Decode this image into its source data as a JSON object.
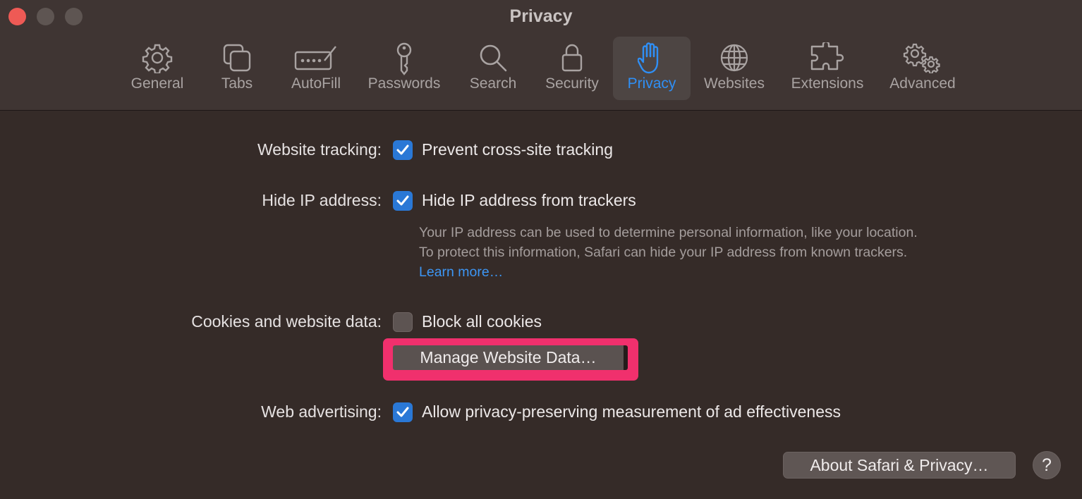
{
  "window": {
    "title": "Privacy"
  },
  "toolbar": {
    "tabs": [
      {
        "label": "General",
        "icon": "gear-icon"
      },
      {
        "label": "Tabs",
        "icon": "tabs-icon"
      },
      {
        "label": "AutoFill",
        "icon": "autofill-icon"
      },
      {
        "label": "Passwords",
        "icon": "key-icon"
      },
      {
        "label": "Search",
        "icon": "search-icon"
      },
      {
        "label": "Security",
        "icon": "lock-icon"
      },
      {
        "label": "Privacy",
        "icon": "hand-icon",
        "selected": true
      },
      {
        "label": "Websites",
        "icon": "globe-icon"
      },
      {
        "label": "Extensions",
        "icon": "puzzle-icon"
      },
      {
        "label": "Advanced",
        "icon": "gears-icon"
      }
    ]
  },
  "settings": {
    "website_tracking": {
      "label": "Website tracking:",
      "option": "Prevent cross-site tracking",
      "checked": true
    },
    "hide_ip": {
      "label": "Hide IP address:",
      "option": "Hide IP address from trackers",
      "checked": true,
      "description": "Your IP address can be used to determine personal information, like your location. To protect this information, Safari can hide your IP address from known trackers.",
      "learn_more": "Learn more…"
    },
    "cookies": {
      "label": "Cookies and website data:",
      "option": "Block all cookies",
      "checked": false,
      "manage_button": "Manage Website Data…"
    },
    "web_advertising": {
      "label": "Web advertising:",
      "option": "Allow privacy-preserving measurement of ad effectiveness",
      "checked": true
    }
  },
  "footer": {
    "about_button": "About Safari & Privacy…",
    "help_button": "?"
  },
  "colors": {
    "accent": "#2f8ff5",
    "highlight": "#f0306d",
    "checkbox_on": "#2a78d6"
  }
}
